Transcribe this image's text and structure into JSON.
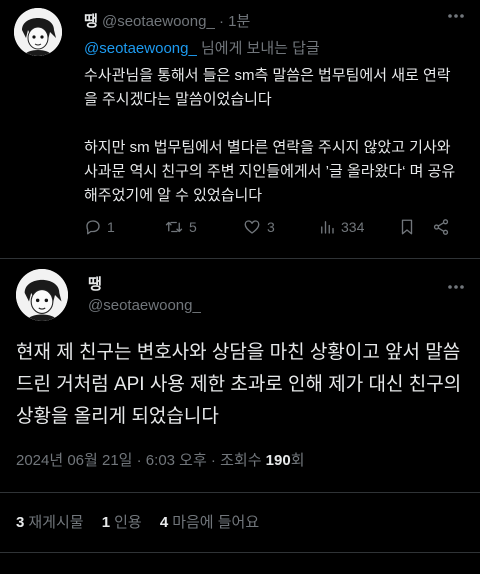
{
  "reply_tweet": {
    "display_name": "땡",
    "handle": "@seotaewoong_",
    "dot": "·",
    "time": "1분",
    "replying_to_handle": "@seotaewoong_",
    "replying_to_suffix": "님에게 보내는 답글",
    "body": "수사관님을 통해서 들은 sm측 말씀은 법무팀에서 새로 연락을 주시겠다는 말씀이었습니다\n\n하지만 sm 법무팀에서 별다른 연락을 주시지 않았고 기사와 사과문 역시 친구의 주변 지인들에게서 ’글 올라왔다‘ 며 공유해주었기에 알 수 있었습니다",
    "replies": "1",
    "retweets": "5",
    "likes": "3",
    "views": "334",
    "more_icon": "ellipsis-icon"
  },
  "main_tweet": {
    "display_name": "땡",
    "handle": "@seotaewoong_",
    "body": "현재 제 친구는 변호사와 상담을 마친 상황이고 앞서 말씀드린 거처럼 API 사용 제한 초과로 인해 제가 대신 친구의 상황을 올리게 되었습니다",
    "timestamp": "2024년 06월 21일 · 6:03 오후 · 조회수 ",
    "view_count": "190",
    "view_unit": "회",
    "stats": {
      "retweets_count": "3",
      "retweets_label": "재게시물",
      "quotes_count": "1",
      "quotes_label": "인용",
      "likes_count": "4",
      "likes_label": "마음에 들어요"
    }
  },
  "colors": {
    "background": "#000000",
    "text": "#e7e9ea",
    "muted": "#71767b",
    "link": "#1d9bf0",
    "divider": "#2f3336"
  }
}
